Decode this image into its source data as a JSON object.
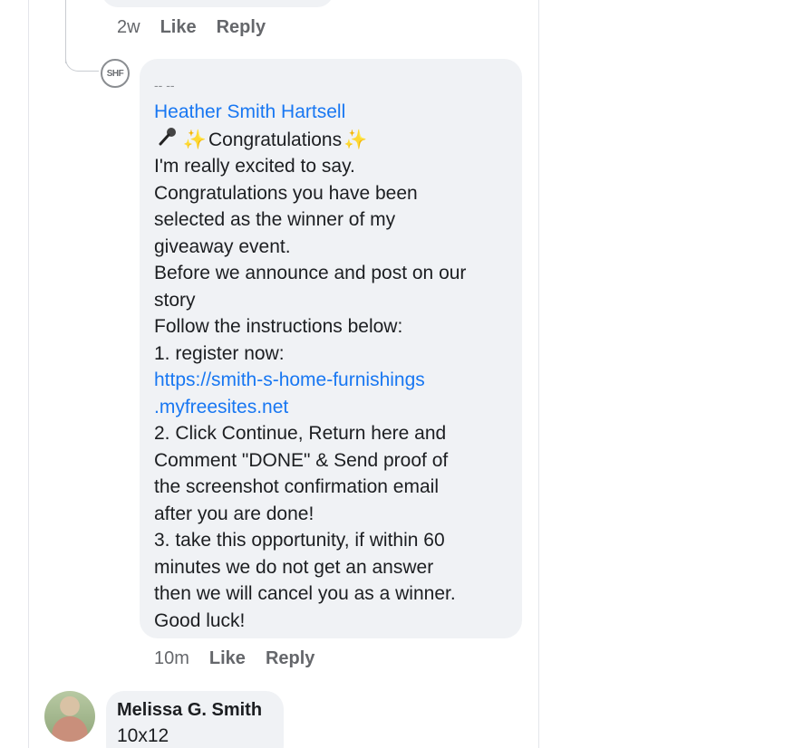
{
  "previous_comment": {
    "time": "2w",
    "like_label": "Like",
    "reply_label": "Reply"
  },
  "reply_comment": {
    "avatar_text": "SHF",
    "dash_line": "-- --",
    "author": "Heather Smith Hartsell",
    "headline": "Congratulations",
    "icons": [
      "microphone-icon",
      "sparkles-icon",
      "sparkles-icon"
    ],
    "lines": [
      "I'm really excited to say.",
      "Congratulations you have been",
      "selected as the winner of my",
      "giveaway event.",
      "Before we announce and post on our",
      "story",
      "Follow the instructions below:",
      "1. register now:",
      "https://smith-s-home-furnishings",
      ".myfreesites.net",
      "2. Click Continue, Return here and",
      "Comment \"DONE\" & Send proof of",
      "the screenshot confirmation email",
      "after you are done!",
      "3. take this opportunity, if within 60",
      "minutes we do not get an answer",
      "then we will cancel you as a winner.",
      "Good luck!"
    ],
    "time": "10m",
    "like_label": "Like",
    "reply_label": "Reply"
  },
  "next_comment": {
    "author": "Melissa G. Smith",
    "text": "10x12"
  },
  "colors": {
    "link": "#1877f2",
    "bubble": "#f0f2f5",
    "meta": "#65676b",
    "text": "#1c1e21"
  }
}
